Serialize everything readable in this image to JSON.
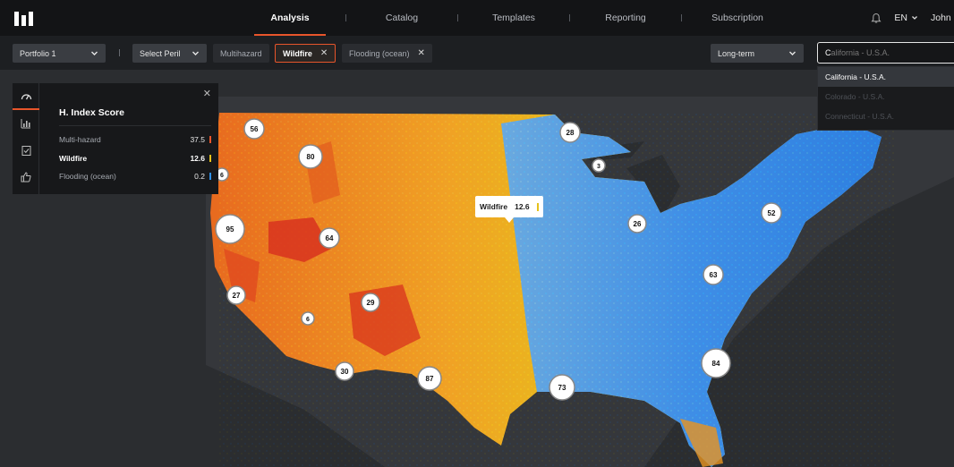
{
  "nav": {
    "tabs": [
      {
        "label": "Analysis",
        "active": true
      },
      {
        "label": "Catalog",
        "active": false
      },
      {
        "label": "Templates",
        "active": false
      },
      {
        "label": "Reporting",
        "active": false
      },
      {
        "label": "Subscription",
        "active": false
      }
    ],
    "language": "EN",
    "user": "John"
  },
  "toolbar": {
    "portfolio": "Portfolio 1",
    "peril_select": "Select Peril",
    "chips": [
      {
        "label": "Multihazard",
        "selected": false,
        "closable": false
      },
      {
        "label": "Wildfire",
        "selected": true,
        "closable": true
      },
      {
        "label": "Flooding (ocean)",
        "selected": false,
        "closable": true
      }
    ],
    "horizon": "Long-term",
    "search": {
      "typed": "C",
      "hint": "alifornia - U.S.A."
    },
    "suggestions": [
      {
        "label": "California - U.S.A.",
        "highlighted": true
      },
      {
        "label": "Colorado - U.S.A.",
        "highlighted": false
      },
      {
        "label": "Connecticut - U.S.A.",
        "highlighted": false
      }
    ]
  },
  "panel": {
    "title": "H. Index Score",
    "rows": [
      {
        "label": "Multi-hazard",
        "value": "37.5",
        "color": "#e8552b",
        "bold": false
      },
      {
        "label": "Wildfire",
        "value": "12.6",
        "color": "#e6c21a",
        "bold": true
      },
      {
        "label": "Flooding (ocean)",
        "value": "0.2",
        "color": "#2f8fe6",
        "bold": false
      }
    ]
  },
  "tooltip": {
    "label": "Wildfire",
    "value": "12.6"
  },
  "clusters": [
    {
      "count": "56"
    },
    {
      "count": "80"
    },
    {
      "count": "6"
    },
    {
      "count": "95"
    },
    {
      "count": "64"
    },
    {
      "count": "27"
    },
    {
      "count": "29"
    },
    {
      "count": "6"
    },
    {
      "count": "30"
    },
    {
      "count": "87"
    },
    {
      "count": "28"
    },
    {
      "count": "3"
    },
    {
      "count": "26"
    },
    {
      "count": "52"
    },
    {
      "count": "63"
    },
    {
      "count": "84"
    },
    {
      "count": "73"
    }
  ],
  "colors": {
    "accent": "#e8552b",
    "wildfire": "#e6c21a",
    "flood": "#2f8fe6"
  }
}
